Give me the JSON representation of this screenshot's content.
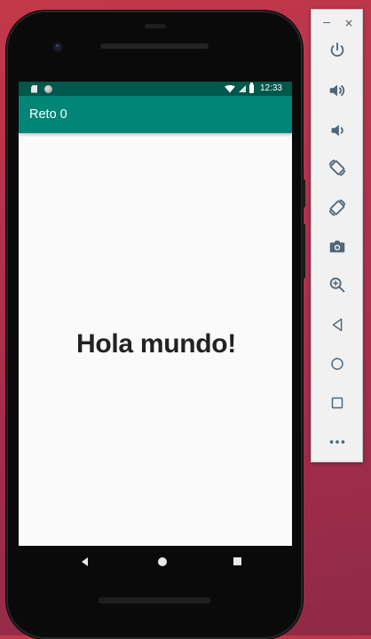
{
  "app": {
    "title": "Reto 0",
    "message": "Hola mundo!"
  },
  "status_bar": {
    "time": "12:33",
    "icons": [
      "sd-card-icon",
      "sync-circle-icon",
      "wifi-icon",
      "cell-signal-icon",
      "battery-icon"
    ]
  },
  "phone_nav": {
    "buttons": [
      "back-icon",
      "home-icon",
      "recents-icon"
    ]
  },
  "emulator_toolbar": {
    "window_controls": {
      "minimize": "–",
      "close": "×"
    },
    "buttons": [
      "power-icon",
      "volume-up-icon",
      "volume-down-icon",
      "rotate-left-icon",
      "rotate-right-icon",
      "camera-icon",
      "zoom-icon",
      "back-icon",
      "home-icon",
      "overview-icon",
      "more-icon"
    ]
  },
  "colors": {
    "status_bar": "#00574b",
    "app_bar": "#008577",
    "screen_background": "#fafafa",
    "message_text": "#222222",
    "toolbar_icon": "#506678"
  }
}
